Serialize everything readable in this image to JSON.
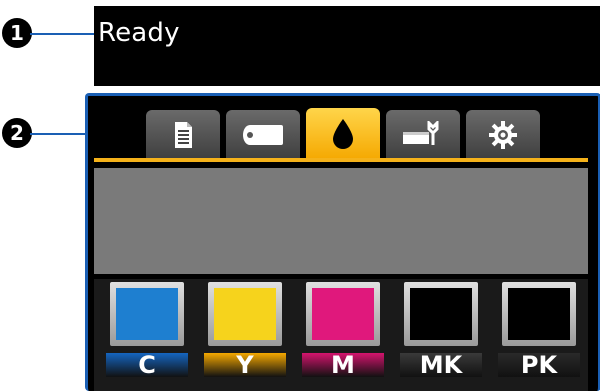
{
  "callouts": [
    "1",
    "2"
  ],
  "status": {
    "text": "Ready"
  },
  "tabs": [
    {
      "name": "print-queue-icon",
      "active": false
    },
    {
      "name": "paper-roll-icon",
      "active": false
    },
    {
      "name": "ink-drop-icon",
      "active": true
    },
    {
      "name": "maintenance-icon",
      "active": false
    },
    {
      "name": "settings-gear-icon",
      "active": false
    }
  ],
  "colors": {
    "accent": "#f5b21a",
    "callout_line": "#1a5fb4",
    "info_area": "#7a7a7a"
  },
  "inks": [
    {
      "label": "C",
      "color": "#1e7fd0",
      "label_bg": "#1565c0"
    },
    {
      "label": "Y",
      "color": "#f6d31c",
      "label_bg": "#f5a800"
    },
    {
      "label": "M",
      "color": "#e0187c",
      "label_bg": "#d4146e"
    },
    {
      "label": "MK",
      "color": "#000000",
      "label_bg": "#3a3a3a"
    },
    {
      "label": "PK",
      "color": "#000000",
      "label_bg": "#2a2a2a"
    }
  ]
}
